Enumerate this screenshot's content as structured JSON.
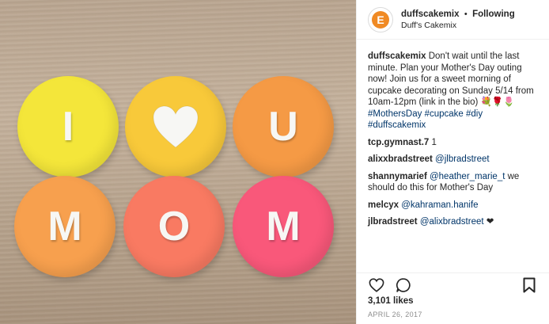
{
  "photo": {
    "top_row": [
      {
        "letter": "I",
        "color": "#f4e63a"
      },
      {
        "letter": "",
        "icon": "heart-icon",
        "color": "#f8c93a"
      },
      {
        "letter": "U",
        "color": "#f59a45"
      }
    ],
    "bottom_row": [
      {
        "letter": "M",
        "color": "#f7a04e"
      },
      {
        "letter": "O",
        "color": "#f97a62"
      },
      {
        "letter": "M",
        "color": "#f9587a"
      }
    ]
  },
  "header": {
    "username": "duffscakemix",
    "separator": "•",
    "following_label": "Following",
    "display_name": "Duff's Cakemix",
    "avatar_icon": "duffs-logo-icon",
    "avatar_letter": "E"
  },
  "caption": {
    "username": "duffscakemix",
    "text": "Don't wait until the last minute. Plan your Mother's Day outing now! Join us for a sweet morning of cupcake decorating on Sunday 5/14 from 10am-12pm (link in the bio) 💐🌹🌷",
    "hashtags": "#MothersDay #cupcake #diy #duffscakemix"
  },
  "comments": [
    {
      "user": "tcp.gymnast.7",
      "text": "1",
      "mention": ""
    },
    {
      "user": "alixxbradstreet",
      "text": "",
      "mention": "@jlbradstreet"
    },
    {
      "user": "shannymarief",
      "text": "we should do this for Mother's Day",
      "mention": "@heather_marie_t"
    },
    {
      "user": "melcyx",
      "text": "",
      "mention": "@kahraman.hanife"
    },
    {
      "user": "jlbradstreet",
      "text": "❤",
      "mention": "@alixbradstreet"
    }
  ],
  "actions": {
    "like_icon": "heart-outline-icon",
    "comment_icon": "comment-icon",
    "bookmark_icon": "bookmark-icon"
  },
  "likes": "3,101 likes",
  "date": "APRIL 26, 2017",
  "colors": {
    "link": "#003569",
    "muted": "#8e8e8e",
    "brand": "#f08a24"
  }
}
